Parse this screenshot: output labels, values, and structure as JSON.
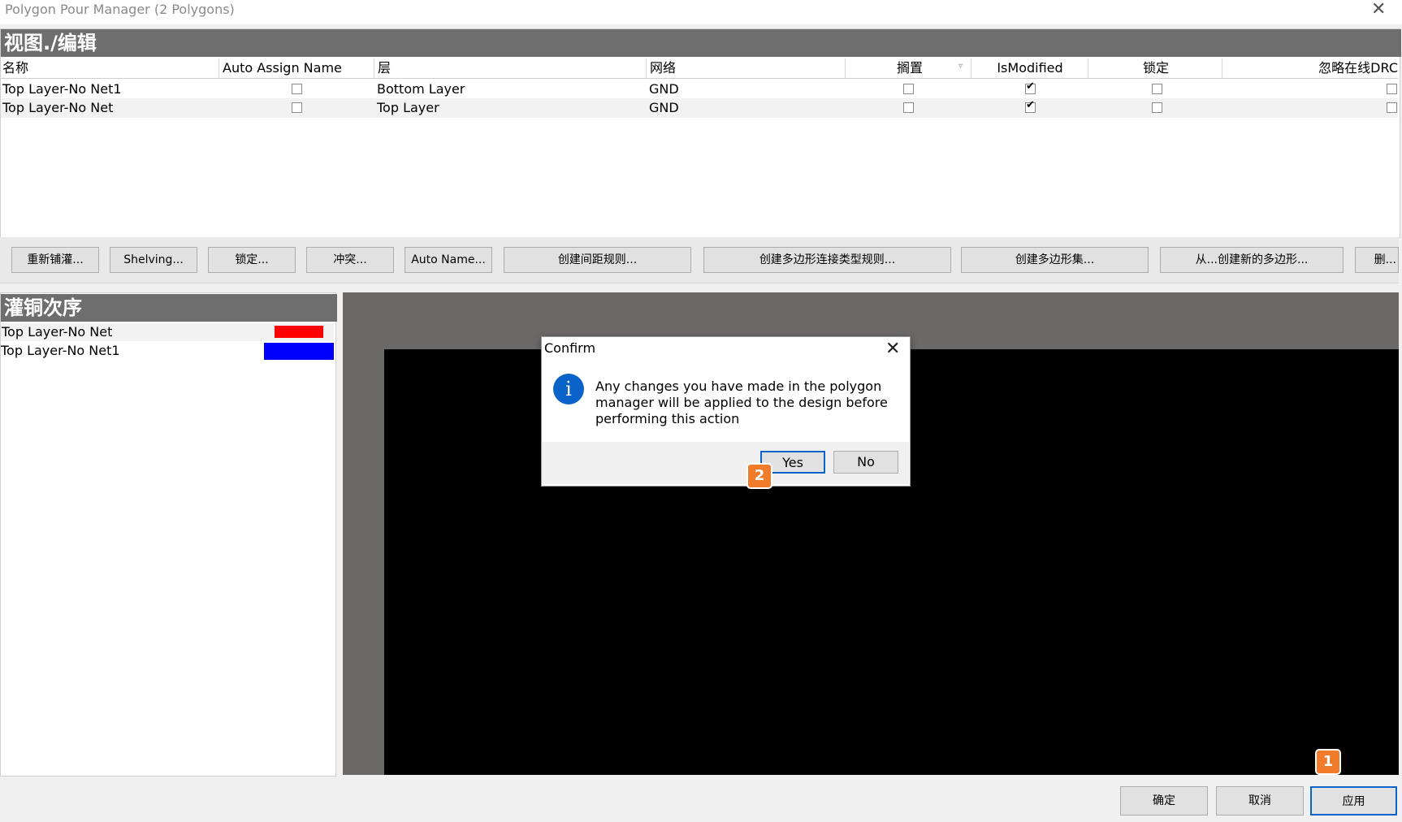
{
  "window": {
    "title": "Polygon Pour Manager (2 Polygons)"
  },
  "edit_section": {
    "title": "视图./编辑"
  },
  "table": {
    "columns": [
      "名称",
      "Auto Assign Name",
      "层",
      "网络",
      "搁置",
      "IsModified",
      "锁定",
      "忽略在线DRC"
    ],
    "rows": [
      {
        "name": "Top Layer-No Net1",
        "auto_assign": false,
        "layer": "Bottom Layer",
        "net": "GND",
        "shelved": false,
        "modified": true,
        "locked": false,
        "ignore_drc": false
      },
      {
        "name": "Top Layer-No Net",
        "auto_assign": false,
        "layer": "Top Layer",
        "net": "GND",
        "shelved": false,
        "modified": true,
        "locked": false,
        "ignore_drc": false
      }
    ]
  },
  "toolbar": {
    "buttons": [
      "重新铺灌...",
      "Shelving...",
      "锁定...",
      "冲突...",
      "Auto Name...",
      "创建间距规则...",
      "创建多边形连接类型规则...",
      "创建多边形集...",
      "从...创建新的多边形...",
      "删..."
    ]
  },
  "pour_order": {
    "title": "灌铜次序",
    "items": [
      {
        "name": "Top Layer-No Net",
        "color": "#ff0000"
      },
      {
        "name": "Top Layer-No Net1",
        "color": "#0000ff"
      }
    ]
  },
  "dialog": {
    "title": "Confirm",
    "message": "Any changes you have made in the polygon manager will be applied to the design before performing this action",
    "yes_label": "Yes",
    "no_label": "No",
    "icon": "info-icon"
  },
  "footer": {
    "ok_label": "确定",
    "cancel_label": "取消",
    "apply_label": "应用"
  },
  "annotations": {
    "badge1": "1",
    "badge2": "2"
  },
  "colors": {
    "section_header": "#6e6e6e",
    "accent": "#0a63c9",
    "badge": "#f07b2a",
    "preview_bg": "#6b6868"
  }
}
